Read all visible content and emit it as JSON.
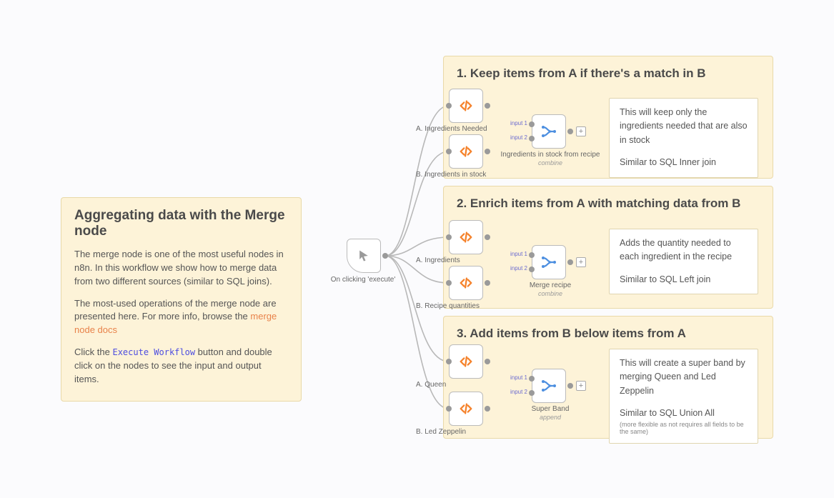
{
  "intro": {
    "title": "Aggregating data with the Merge node",
    "p1": "The merge node is one of the most useful nodes in n8n. In this workflow we show how to merge data from two different sources (similar to SQL joins).",
    "p2_a": "The most-used operations of the merge node are presented here. For more info, browse the ",
    "p2_link": "merge node docs",
    "p3_a": "Click the ",
    "p3_code": "Execute Workflow",
    "p3_b": " button and double click on the nodes to see the input and output items."
  },
  "trigger": {
    "label": "On clicking 'execute'"
  },
  "section1": {
    "title": "1. Keep items from A if there's a match in B",
    "nodeA": "A. Ingredients Needed",
    "nodeB": "B. Ingredients in stock",
    "merge": "Ingredients in stock from recipe",
    "merge_sub": "combine",
    "input1": "input 1",
    "input2": "input 2",
    "note_a": "This will keep only the ingredients needed that are also in stock",
    "note_b": "Similar to SQL Inner join"
  },
  "section2": {
    "title": "2. Enrich items from A with matching data from B",
    "nodeA": "A. Ingredients",
    "nodeB": "B. Recipe quantities",
    "merge": "Merge recipe",
    "merge_sub": "combine",
    "input1": "input 1",
    "input2": "input 2",
    "note_a": "Adds the quantity needed to each ingredient in the recipe",
    "note_b": "Similar to SQL Left join"
  },
  "section3": {
    "title": "3. Add items from B below items from A",
    "nodeA": "A. Queen",
    "nodeB": "B. Led Zeppelin",
    "merge": "Super Band",
    "merge_sub": "append",
    "input1": "input 1",
    "input2": "input 2",
    "note_a": "This will create a super band by merging Queen and Led Zeppelin",
    "note_b": "Similar to SQL Union All",
    "note_c": "(more flexible as not requires all fields to be the same)"
  }
}
